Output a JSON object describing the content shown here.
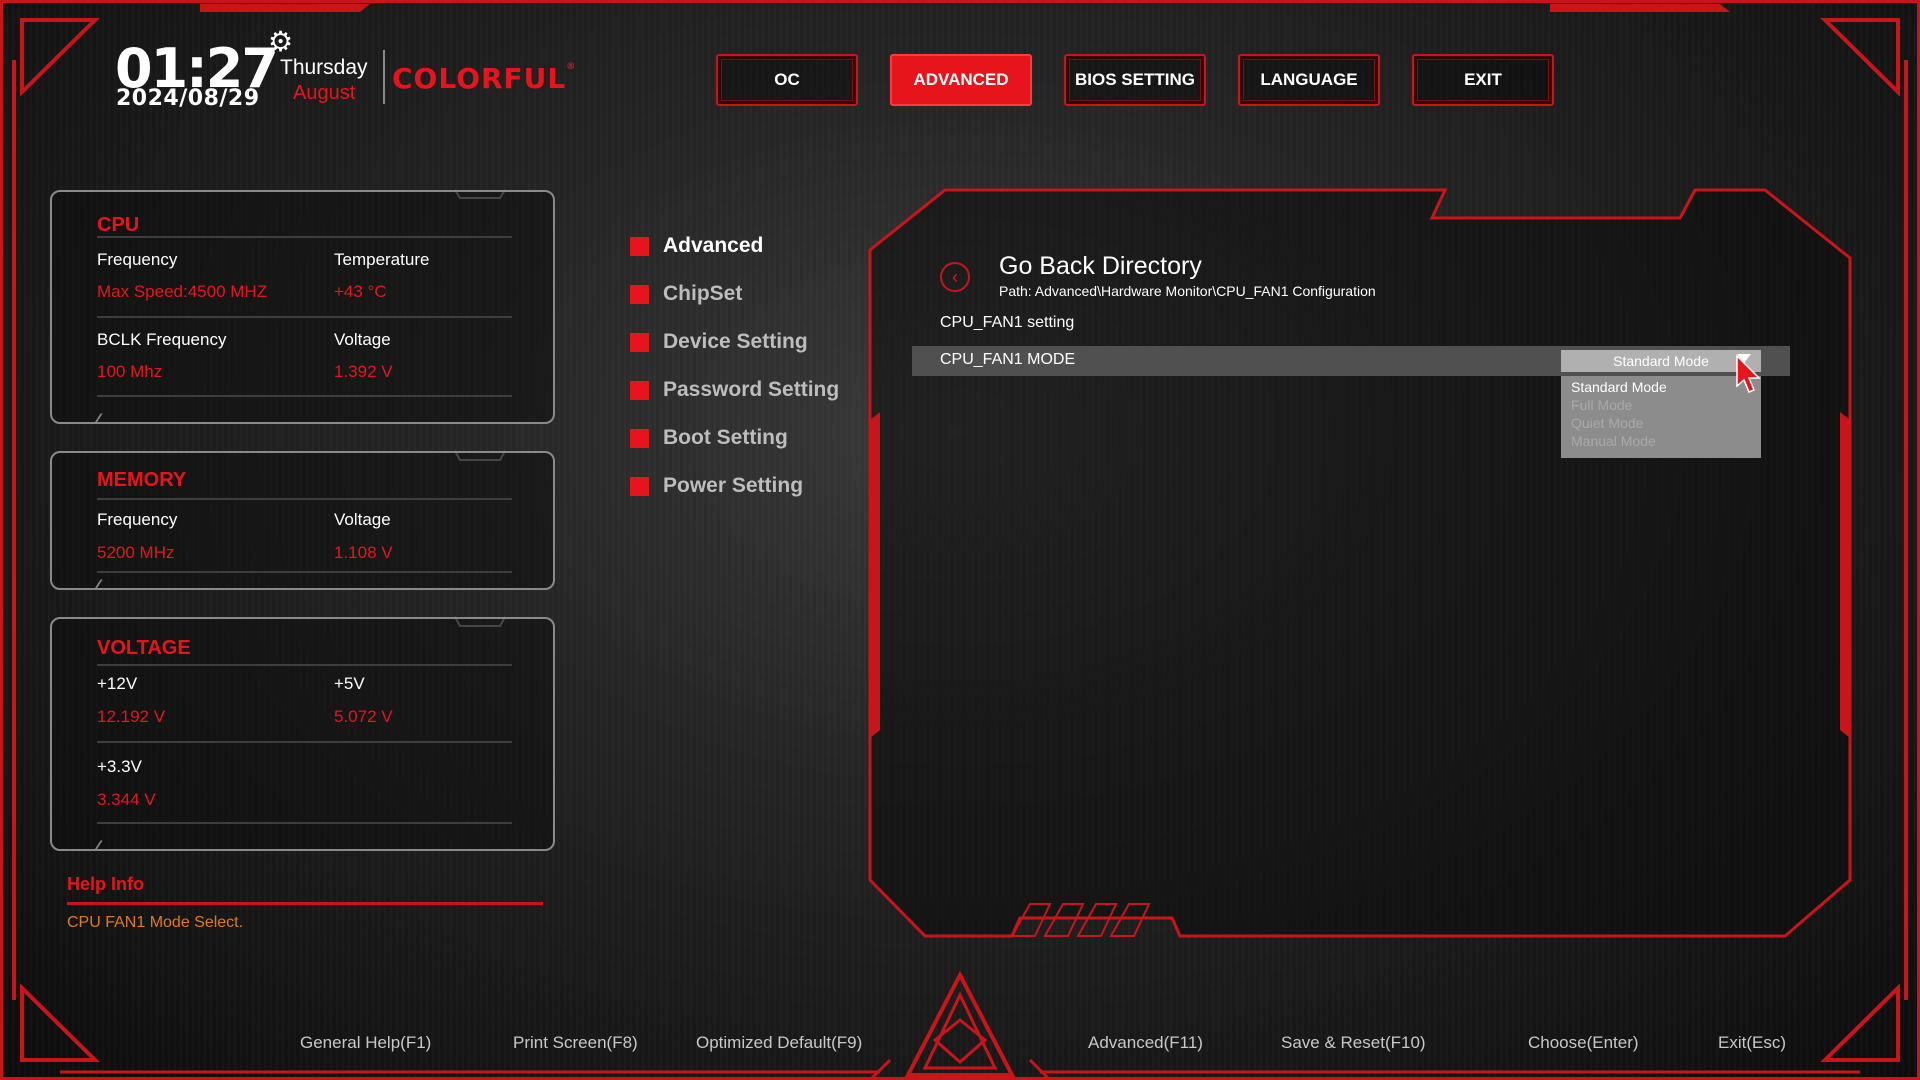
{
  "header": {
    "time": "01:27",
    "date": "2024/08/29",
    "weekday": "Thursday",
    "month": "August",
    "brand": "COLORFUL",
    "brand_mark": "®",
    "settings_icon": "gear-icon"
  },
  "topnav": [
    {
      "label": "OC",
      "active": false
    },
    {
      "label": "ADVANCED",
      "active": true
    },
    {
      "label": "BIOS SETTING",
      "active": false
    },
    {
      "label": "LANGUAGE",
      "active": false
    },
    {
      "label": "EXIT",
      "active": false
    }
  ],
  "cpu": {
    "title": "CPU",
    "frequency_label": "Frequency",
    "frequency_value": "Max Speed:4500 MHZ",
    "temperature_label": "Temperature",
    "temperature_value": "+43 °C",
    "bclk_label": "BCLK Frequency",
    "bclk_value": "100 Mhz",
    "voltage_label": "Voltage",
    "voltage_value": "1.392 V"
  },
  "memory": {
    "title": "MEMORY",
    "frequency_label": "Frequency",
    "frequency_value": "5200 MHz",
    "voltage_label": "Voltage",
    "voltage_value": "1.108 V"
  },
  "voltage": {
    "title": "VOLTAGE",
    "v12_label": "+12V",
    "v12_value": "12.192 V",
    "v5_label": "+5V",
    "v5_value": "5.072 V",
    "v33_label": "+3.3V",
    "v33_value": "3.344 V"
  },
  "help": {
    "title": "Help Info",
    "text": "CPU FAN1 Mode Select."
  },
  "menu": [
    {
      "label": "Advanced",
      "active": true
    },
    {
      "label": "ChipSet",
      "active": false
    },
    {
      "label": "Device Setting",
      "active": false
    },
    {
      "label": "Password Setting",
      "active": false
    },
    {
      "label": "Boot Setting",
      "active": false
    },
    {
      "label": "Power Setting",
      "active": false
    }
  ],
  "content": {
    "back_label": "Go Back Directory",
    "path": "Path: Advanced\\Hardware Monitor\\CPU_FAN1 Configuration",
    "section_label": "CPU_FAN1 setting",
    "mode_label": "CPU_FAN1 MODE",
    "mode_value": "Standard Mode",
    "mode_options": [
      "Standard Mode",
      "Full Mode",
      "Quiet Mode",
      "Manual Mode"
    ]
  },
  "footer": [
    "General Help(F1)",
    "Print Screen(F8)",
    "Optimized Default(F9)",
    "Advanced(F11)",
    "Save & Reset(F10)",
    "Choose(Enter)",
    "Exit(Esc)"
  ],
  "colors": {
    "accent": "#e8141c",
    "help_text": "#e07a1f",
    "row_bg": "#505050"
  }
}
